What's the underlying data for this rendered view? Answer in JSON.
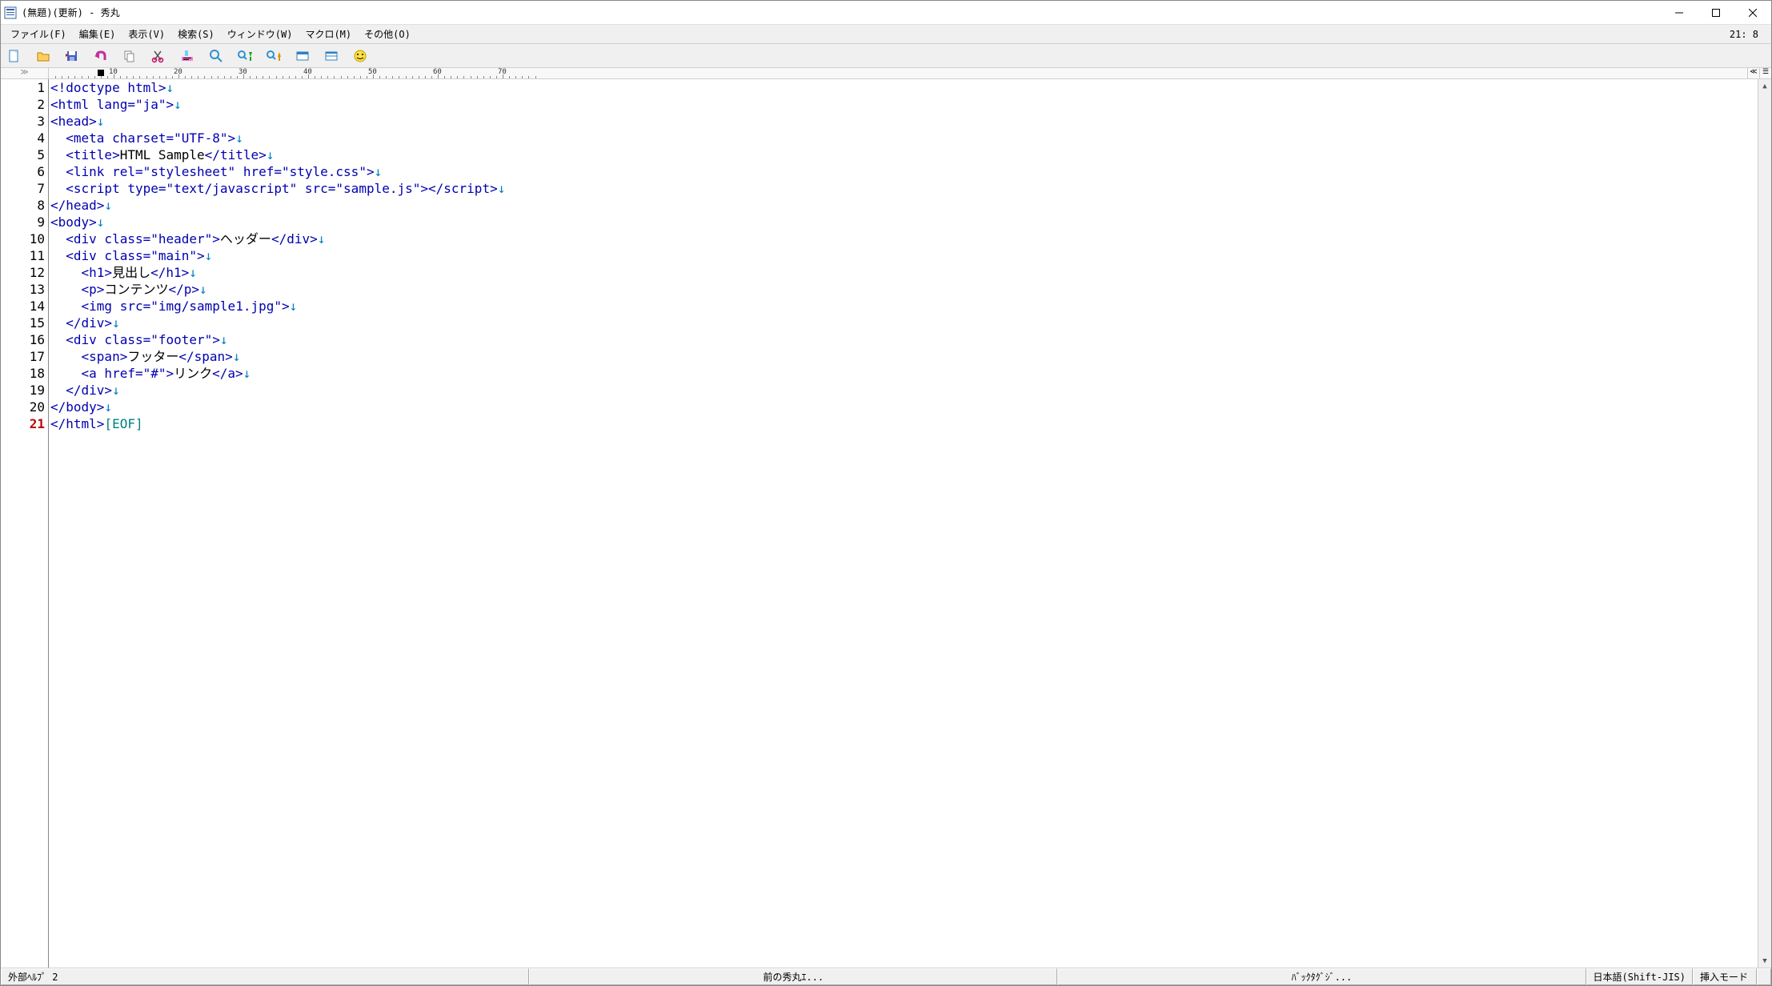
{
  "titlebar": {
    "title": "(無題)(更新) - 秀丸"
  },
  "menu": {
    "items": [
      "ファイル(F)",
      "編集(E)",
      "表示(V)",
      "検索(S)",
      "ウィンドウ(W)",
      "マクロ(M)",
      "その他(O)"
    ],
    "cursor_pos": "21: 8"
  },
  "toolbar": {
    "icons": [
      "new-file",
      "open-folder",
      "save",
      "arrow-redo",
      "copy",
      "cut",
      "highlight",
      "search",
      "search-down",
      "search-up",
      "window",
      "split",
      "help"
    ]
  },
  "ruler": {
    "expand": "≫",
    "marks": [
      10,
      20,
      30,
      40,
      50,
      60,
      70
    ],
    "cursor_col": 8,
    "right_a": "≪",
    "right_b": "☰"
  },
  "code": {
    "lines": [
      {
        "n": 1,
        "html": "<span class='tag'>&lt;!doctype html&gt;</span><span class='eol'>↓</span>"
      },
      {
        "n": 2,
        "html": "<span class='tag'>&lt;html lang=\"ja\"&gt;</span><span class='eol'>↓</span>"
      },
      {
        "n": 3,
        "html": "<span class='tag'>&lt;head&gt;</span><span class='eol'>↓</span>"
      },
      {
        "n": 4,
        "html": "  <span class='tag'>&lt;meta charset=\"UTF-8\"&gt;</span><span class='eol'>↓</span>"
      },
      {
        "n": 5,
        "html": "  <span class='tag'>&lt;title&gt;</span><span class='txt'>HTML Sample</span><span class='tag'>&lt;/title&gt;</span><span class='eol'>↓</span>"
      },
      {
        "n": 6,
        "html": "  <span class='tag'>&lt;link rel=\"stylesheet\" href=\"style.css\"&gt;</span><span class='eol'>↓</span>"
      },
      {
        "n": 7,
        "html": "  <span class='tag'>&lt;script type=\"text/javascript\" src=\"sample.js\"&gt;&lt;/script&gt;</span><span class='eol'>↓</span>"
      },
      {
        "n": 8,
        "html": "<span class='tag'>&lt;/head&gt;</span><span class='eol'>↓</span>"
      },
      {
        "n": 9,
        "html": "<span class='tag'>&lt;body&gt;</span><span class='eol'>↓</span>"
      },
      {
        "n": 10,
        "html": "  <span class='tag'>&lt;div class=\"header\"&gt;</span><span class='txt'>ヘッダー</span><span class='tag'>&lt;/div&gt;</span><span class='eol'>↓</span>"
      },
      {
        "n": 11,
        "html": "  <span class='tag'>&lt;div class=\"main\"&gt;</span><span class='eol'>↓</span>"
      },
      {
        "n": 12,
        "html": "    <span class='tag'>&lt;h1&gt;</span><span class='txt'>見出し</span><span class='tag'>&lt;/h1&gt;</span><span class='eol'>↓</span>"
      },
      {
        "n": 13,
        "html": "    <span class='tag'>&lt;p&gt;</span><span class='txt'>コンテンツ</span><span class='tag'>&lt;/p&gt;</span><span class='eol'>↓</span>"
      },
      {
        "n": 14,
        "html": "    <span class='tag'>&lt;img src=\"img/sample1.jpg\"&gt;</span><span class='eol'>↓</span>"
      },
      {
        "n": 15,
        "html": "  <span class='tag'>&lt;/div&gt;</span><span class='eol'>↓</span>"
      },
      {
        "n": 16,
        "html": "  <span class='tag'>&lt;div class=\"footer\"&gt;</span><span class='eol'>↓</span>"
      },
      {
        "n": 17,
        "html": "    <span class='tag'>&lt;span&gt;</span><span class='txt'>フッター</span><span class='tag'>&lt;/span&gt;</span><span class='eol'>↓</span>"
      },
      {
        "n": 18,
        "html": "    <span class='tag'>&lt;a href=\"#\"&gt;</span><span class='txt'>リンク</span><span class='tag'>&lt;/a&gt;</span><span class='eol'>↓</span>"
      },
      {
        "n": 19,
        "html": "  <span class='tag'>&lt;/div&gt;</span><span class='eol'>↓</span>"
      },
      {
        "n": 20,
        "html": "<span class='tag'>&lt;/body&gt;</span><span class='eol'>↓</span>"
      },
      {
        "n": 21,
        "html": "<span class='tag'>&lt;/html&gt;</span><span class='eof'>[EOF]</span>"
      }
    ],
    "current_line": 21
  },
  "statusbar": {
    "help": "外部ﾍﾙﾌﾟ 2",
    "prev": "前の秀丸ｴ...",
    "backtag": "ﾊﾞｯｸﾀｸﾞｼﾞ...",
    "encoding": "日本語(Shift-JIS)",
    "mode": "挿入モード"
  }
}
